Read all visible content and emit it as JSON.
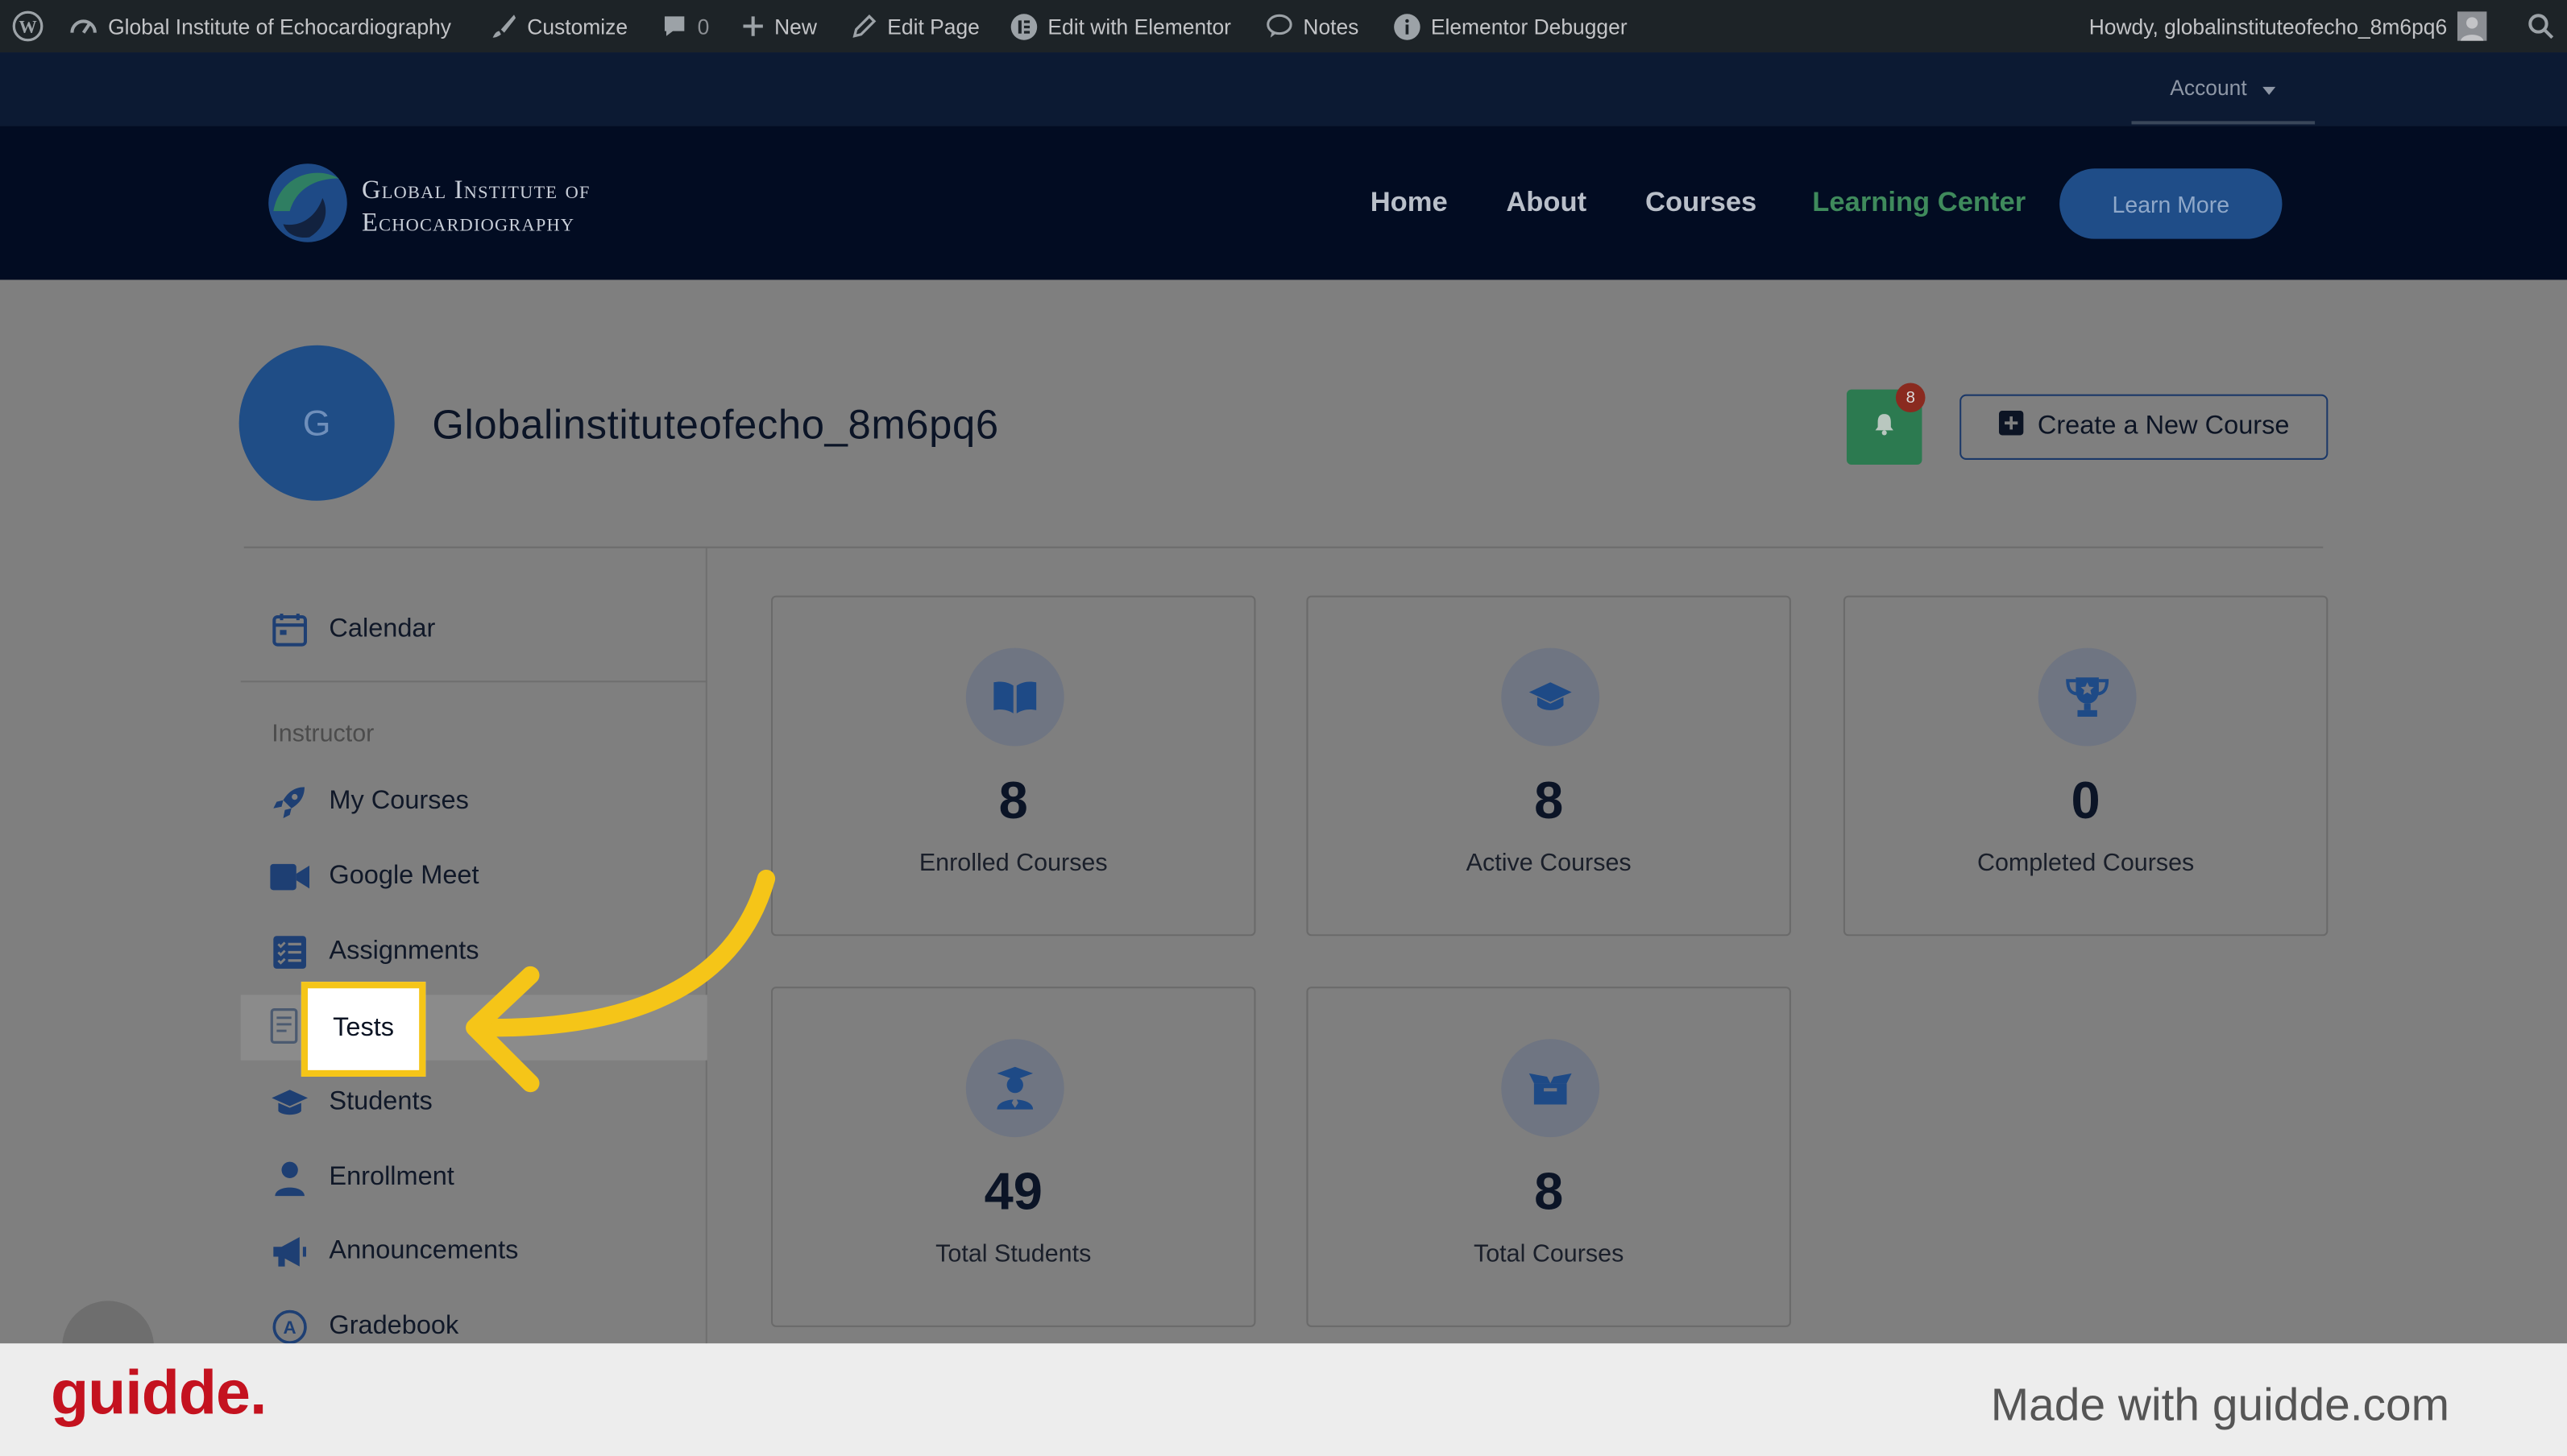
{
  "admin_bar": {
    "site_name": "Global Institute of Echocardiography",
    "customize": "Customize",
    "comments_count": "0",
    "new": "New",
    "edit_page": "Edit Page",
    "edit_elementor": "Edit with Elementor",
    "notes": "Notes",
    "debugger": "Elementor Debugger",
    "howdy": "Howdy, globalinstituteofecho_8m6pq6"
  },
  "account_menu": {
    "label": "Account"
  },
  "header": {
    "logo_line1": "Global Institute of",
    "logo_line2": "Echocardiography",
    "nav": [
      "Home",
      "About",
      "Courses",
      "Learning Center"
    ],
    "cta": "Learn More"
  },
  "profile": {
    "avatar_initial": "G",
    "username": "Globalinstituteofecho_8m6pq6",
    "notification_count": "8",
    "create_course": "Create a New Course"
  },
  "sidebar": {
    "calendar": "Calendar",
    "section": "Instructor",
    "items": [
      "My Courses",
      "Google Meet",
      "Assignments",
      "Tests",
      "Students",
      "Enrollment",
      "Announcements",
      "Gradebook"
    ],
    "selected": "Tests"
  },
  "stats": [
    {
      "value": "8",
      "label": "Enrolled Courses",
      "icon": "book-icon"
    },
    {
      "value": "8",
      "label": "Active Courses",
      "icon": "graduation-cap-icon"
    },
    {
      "value": "0",
      "label": "Completed Courses",
      "icon": "trophy-icon"
    },
    {
      "value": "49",
      "label": "Total Students",
      "icon": "student-icon"
    },
    {
      "value": "8",
      "label": "Total Courses",
      "icon": "box-icon"
    }
  ],
  "footer": {
    "brand": "guidde.",
    "made_with": "Made with guidde.com"
  },
  "colors": {
    "highlight": "#f5c518",
    "guidde_red": "#c4121f",
    "accent_green": "#3f8a5c",
    "accent_blue": "#1f4d88"
  }
}
